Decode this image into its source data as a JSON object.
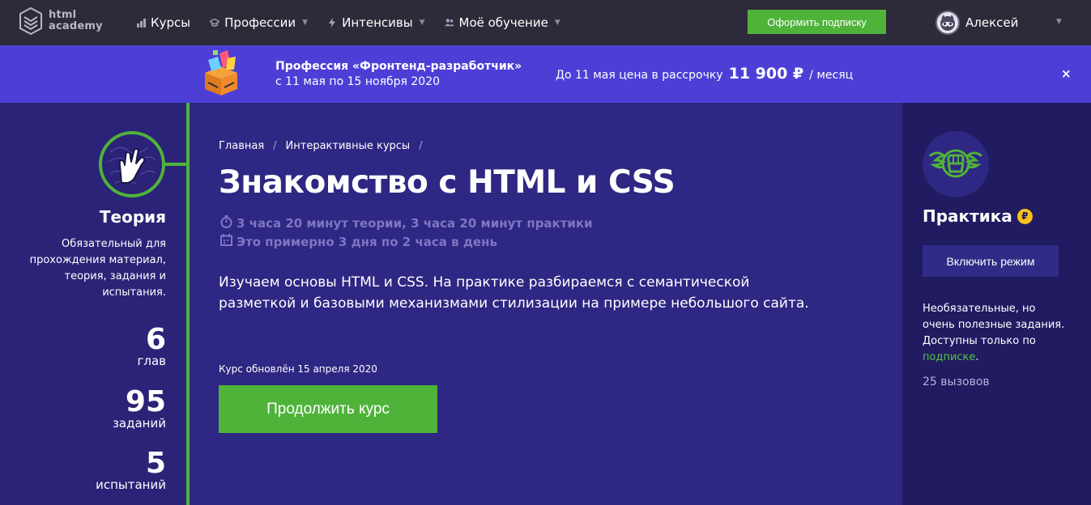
{
  "header": {
    "logo_line1": "html",
    "logo_line2": "academy",
    "nav": [
      {
        "label": "Курсы",
        "icon": "chart-bars-icon",
        "has_caret": false
      },
      {
        "label": "Профессии",
        "icon": "graduation-cap-icon",
        "has_caret": true
      },
      {
        "label": "Интенсивы",
        "icon": "lightning-icon",
        "has_caret": true
      },
      {
        "label": "Моё обучение",
        "icon": "users-icon",
        "has_caret": true
      }
    ],
    "subscribe_label": "Оформить подписку",
    "user_name": "Алексей"
  },
  "promo": {
    "title": "Профессия «Фронтенд-разработчик»",
    "dates": "с 11 мая по 15 ноября 2020",
    "price_prefix": "До 11 мая цена в рассрочку",
    "price_amount": "11 900 ₽",
    "price_suffix": "/ месяц",
    "close": "×"
  },
  "theory": {
    "title": "Теория",
    "description": "Обязательный для прохождения материал, теория, задания и испытания.",
    "stats": [
      {
        "value": "6",
        "label": "глав"
      },
      {
        "value": "95",
        "label": "заданий"
      },
      {
        "value": "5",
        "label": "испытаний"
      }
    ]
  },
  "main": {
    "breadcrumb": [
      "Главная",
      "Интерактивные курсы"
    ],
    "title": "Знакомство с HTML и CSS",
    "meta_time": "3 часа 20 минут теории, 3 часа 20 минут практики",
    "meta_schedule": "Это примерно 3 дня по 2 часа в день",
    "description": "Изучаем основы HTML и CSS. На практике разбираемся с семантической разметкой и базовыми механизмами стилизации на примере небольшого сайта.",
    "updated": "Курс обновлён 15 апреля 2020",
    "continue_label": "Продолжить курс"
  },
  "practice": {
    "title": "Практика",
    "coin": "₽",
    "mode_label": "Включить режим",
    "desc_part1": "Необязательные, но очень полезные задания. Доступны только по",
    "desc_link": "подписке",
    "desc_end": ".",
    "challenges": "25 вызовов"
  },
  "colors": {
    "header_bg": "#2d2a39",
    "promo_bg": "#4d3fd6",
    "page_bg": "#2b2377",
    "main_bg": "#2e2783",
    "right_bg": "#211b61",
    "accent_green": "#4fb33a",
    "coin_yellow": "#f5c01b"
  }
}
